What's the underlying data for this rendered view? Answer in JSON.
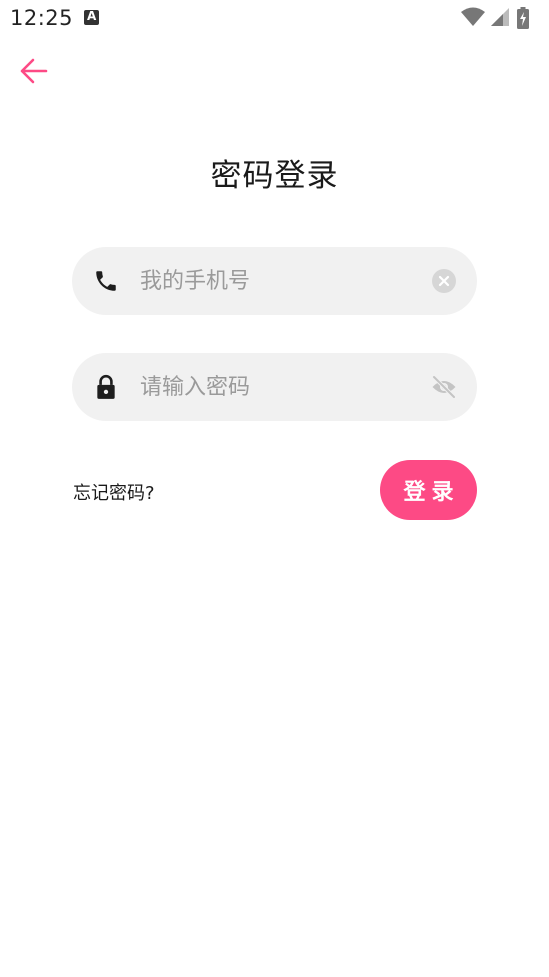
{
  "status_bar": {
    "time": "12:25",
    "notification_icon_letter": "A"
  },
  "colors": {
    "accent": "#fd4a85",
    "field_background": "#f1f1f1",
    "placeholder": "#9a9a9a"
  },
  "page": {
    "title": "密码登录"
  },
  "phone_field": {
    "placeholder": "我的手机号",
    "value": "",
    "leading_icon": "phone-icon",
    "trailing_icon": "clear-icon"
  },
  "password_field": {
    "placeholder": "请输入密码",
    "value": "",
    "leading_icon": "lock-icon",
    "trailing_icon": "eye-off-icon"
  },
  "actions": {
    "forgot_password": "忘记密码?",
    "login": "登录"
  }
}
